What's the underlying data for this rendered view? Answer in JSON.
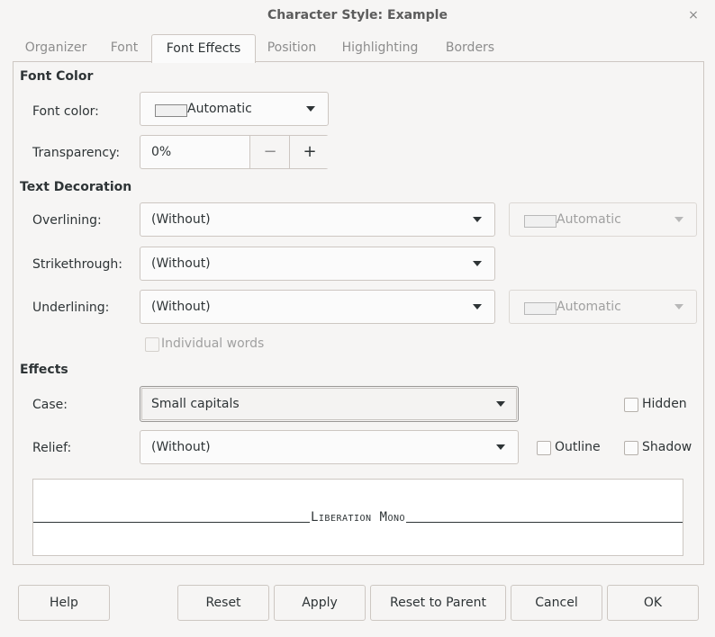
{
  "window": {
    "title": "Character Style: Example",
    "close_glyph": "×"
  },
  "tabs": [
    {
      "label": "Organizer"
    },
    {
      "label": "Font"
    },
    {
      "label": "Font Effects",
      "active": true
    },
    {
      "label": "Position"
    },
    {
      "label": "Highlighting"
    },
    {
      "label": "Borders"
    }
  ],
  "font_color": {
    "heading": "Font Color",
    "color_label": "Font color:",
    "color_value": "Automatic",
    "transparency_label": "Transparency:",
    "transparency_value": "0%",
    "minus": "−",
    "plus": "+"
  },
  "text_decoration": {
    "heading": "Text Decoration",
    "overlining_label": "Overlining:",
    "overlining_value": "(Without)",
    "overlining_color": "Automatic",
    "strikethrough_label": "Strikethrough:",
    "strikethrough_value": "(Without)",
    "underlining_label": "Underlining:",
    "underlining_value": "(Without)",
    "underlining_color": "Automatic",
    "individual_words": "Individual words"
  },
  "effects": {
    "heading": "Effects",
    "case_label": "Case:",
    "case_value": "Small capitals",
    "relief_label": "Relief:",
    "relief_value": "(Without)",
    "hidden": "Hidden",
    "outline": "Outline",
    "shadow": "Shadow"
  },
  "preview": {
    "text": "Liberation Mono"
  },
  "buttons": {
    "help": "Help",
    "reset": "Reset",
    "apply": "Apply",
    "reset_to_parent": "Reset to Parent",
    "cancel": "Cancel",
    "ok": "OK"
  }
}
